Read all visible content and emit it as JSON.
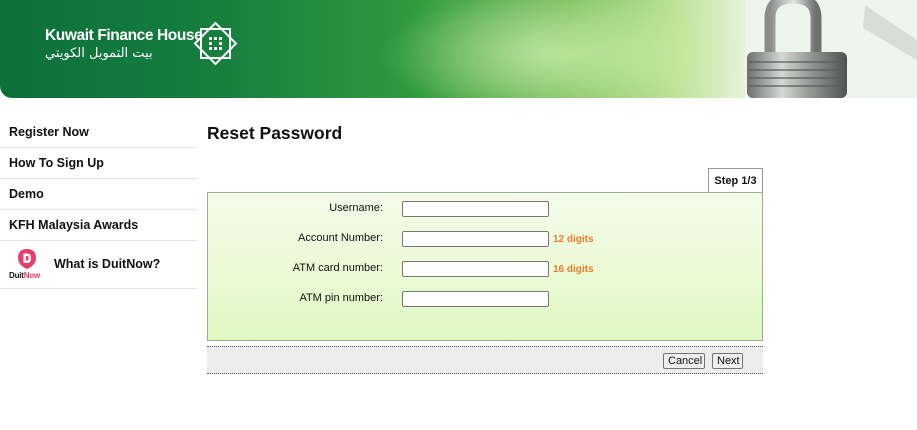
{
  "header": {
    "brand_en": "Kuwait Finance House",
    "brand_ar": "بيت التمويل الكويتي",
    "emblem_icon": "kfh-emblem-icon",
    "banner_image": "padlock-icon",
    "colors": {
      "brand_green": "#0d6f3c",
      "light_green": "#bfe39a"
    }
  },
  "sidebar": {
    "items": [
      {
        "label": "Register Now"
      },
      {
        "label": "How To Sign Up"
      },
      {
        "label": "Demo"
      },
      {
        "label": "KFH Malaysia Awards"
      }
    ],
    "duitnow": {
      "logo_word_1": "Duit",
      "logo_word_2": "Now",
      "label": "What is DuitNow?",
      "accent": "#e83e6c"
    }
  },
  "main": {
    "title": "Reset Password",
    "step": "Step 1/3",
    "fields": [
      {
        "label": "Username:",
        "value": "",
        "hint": ""
      },
      {
        "label": "Account Number:",
        "value": "",
        "hint": "12 digits"
      },
      {
        "label": "ATM card number:",
        "value": "",
        "hint": "16 digits"
      },
      {
        "label": "ATM pin number:",
        "value": "",
        "hint": ""
      }
    ],
    "hint_color": "#e87b2a",
    "buttons": {
      "cancel": "Cancel",
      "next": "Next"
    }
  }
}
